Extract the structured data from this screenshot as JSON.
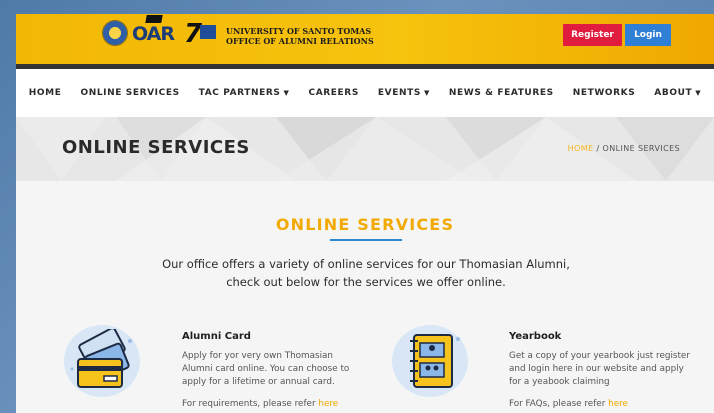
{
  "header": {
    "university_line1": "UNIVERSITY OF SANTO TOMAS",
    "university_line2": "OFFICE OF ALUMNI RELATIONS",
    "logos": [
      "ust-seal-icon",
      "oar-logo-icon",
      "seventy-fifth-anniversary-icon"
    ],
    "register_label": "Register",
    "login_label": "Login",
    "colors": {
      "header_yellow": "#f6c30d",
      "register_red": "#e11d3f",
      "login_blue": "#2f7fd6"
    }
  },
  "nav": {
    "items": [
      {
        "label": "HOME",
        "dropdown": false
      },
      {
        "label": "ONLINE SERVICES",
        "dropdown": false
      },
      {
        "label": "TAC PARTNERS",
        "dropdown": true
      },
      {
        "label": "CAREERS",
        "dropdown": false
      },
      {
        "label": "EVENTS",
        "dropdown": true
      },
      {
        "label": "NEWS & FEATURES",
        "dropdown": false
      },
      {
        "label": "NETWORKS",
        "dropdown": false
      },
      {
        "label": "ABOUT",
        "dropdown": true
      }
    ]
  },
  "banner": {
    "title": "ONLINE SERVICES",
    "breadcrumb_home": "HOME",
    "breadcrumb_sep": "/",
    "breadcrumb_current": "ONLINE SERVICES"
  },
  "main": {
    "section_title": "ONLINE SERVICES",
    "intro_line1": "Our office offers a variety of online services for our Thomasian Alumni,",
    "intro_line2": "check out below for the services we offer online.",
    "accent_color": "#f2a900",
    "cards": [
      {
        "icon": "credit-card-icon",
        "title": "Alumni Card",
        "body_line1": "Apply for yor very own Thomasian",
        "body_line2": "Alumni card online. You can choose to",
        "body_line3": "apply for a lifetime or annual card.",
        "note": "For requirements, please refer",
        "link": "here"
      },
      {
        "icon": "yearbook-icon",
        "title": "Yearbook",
        "body_line1": "Get a copy of your yearbook just register",
        "body_line2": "and login here in our website and apply",
        "body_line3": "for a yeabook claiming",
        "note": "For FAQs, please refer",
        "link": "here"
      }
    ]
  }
}
